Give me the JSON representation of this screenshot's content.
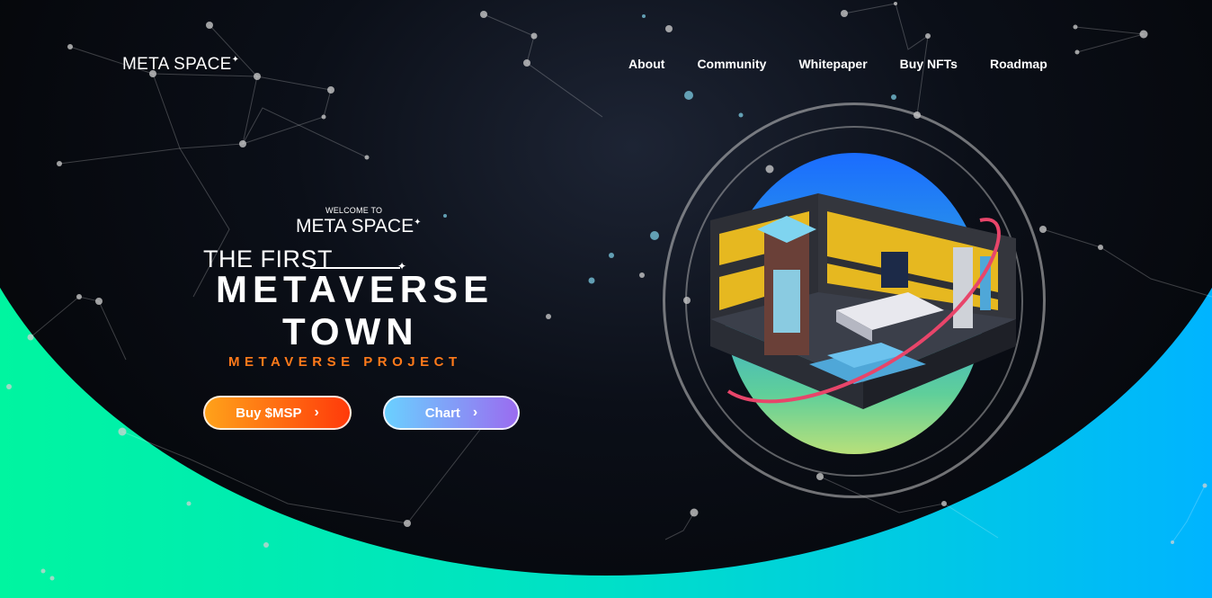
{
  "header": {
    "logo": "META SPACE",
    "logo_spark": "✦",
    "nav": [
      "About",
      "Community",
      "Whitepaper",
      "Buy NFTs",
      "Roadmap"
    ]
  },
  "hero": {
    "welcome": "WELCOME TO",
    "brand": "META SPACE",
    "brand_spark": "✦",
    "first": "THE FIRST",
    "headline_line1": "METAVERSE",
    "headline_line2": "TOWN",
    "tagline": "METAVERSE PROJECT",
    "buy_button": "Buy $MSP",
    "chart_button": "Chart",
    "chevron": "›"
  },
  "colors": {
    "bottom_gradient": [
      "#00f5a0",
      "#00b4ff"
    ],
    "tagline": "#ff7a1a",
    "buy_button": [
      "#ffa21a",
      "#ff3a0a"
    ],
    "chart_button": [
      "#6ad0ff",
      "#9a6cf0"
    ],
    "orbit_ring": "#e8456a"
  },
  "icons": {
    "logo_spark": "sparkle-icon",
    "button_arrow": "chevron-right-icon"
  }
}
